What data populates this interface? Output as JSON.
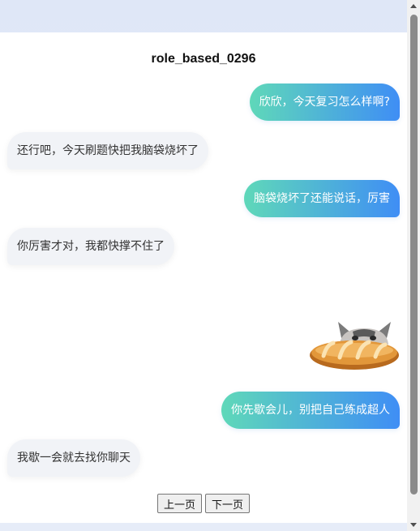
{
  "page": {
    "title": "role_based_0296"
  },
  "messages": [
    {
      "role": "user",
      "text": "欣欣，今天复习怎么样啊?"
    },
    {
      "role": "bot",
      "text": "还行吧，今天刷题快把我脑袋烧坏了"
    },
    {
      "role": "user",
      "text": "脑袋烧坏了还能说话，厉害"
    },
    {
      "role": "bot",
      "text": "你厉害才对，我都快撑不住了"
    },
    {
      "role": "user",
      "sticker": "cat-bread-sticker"
    },
    {
      "role": "user",
      "text": "你先歇会儿，别把自己练成超人"
    },
    {
      "role": "bot",
      "text": "我歇一会就去找你聊天"
    }
  ],
  "pager": {
    "prev_label": "上一页",
    "next_label": "下一页"
  },
  "colors": {
    "user_bubble_start": "#5fd8b9",
    "user_bubble_end": "#3f8ef5",
    "bot_bubble": "#f1f3f7"
  }
}
